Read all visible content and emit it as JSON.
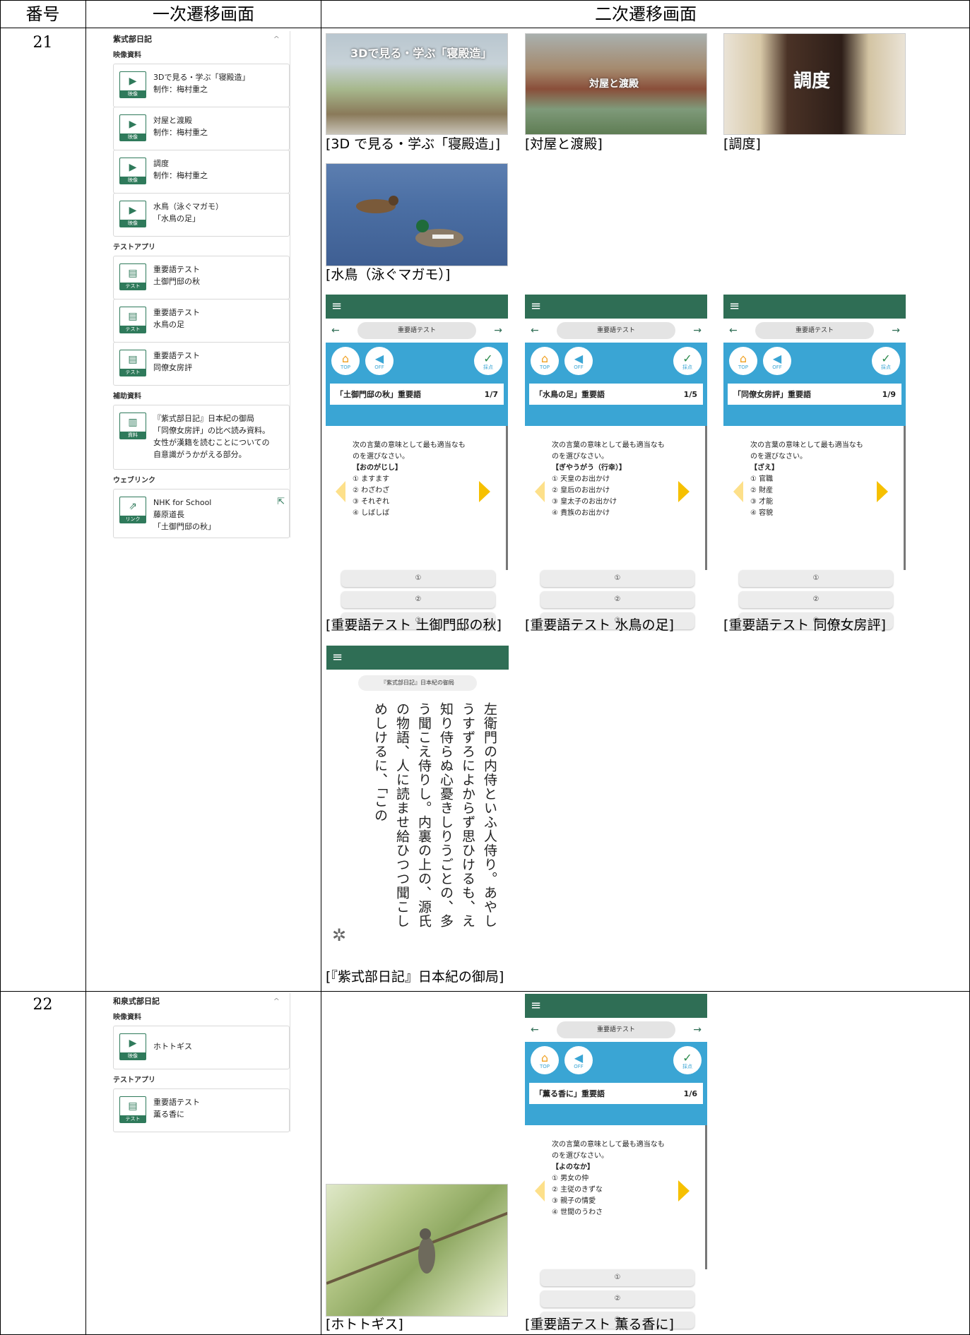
{
  "headers": {
    "num": "番号",
    "primary": "一次遷移画面",
    "secondary": "二次遷移画面"
  },
  "rows": [
    {
      "number": "21",
      "panel": {
        "title": "紫式部日記",
        "sections": {
          "video": "映像資料",
          "test": "テストアプリ",
          "aux": "補助資料",
          "web": "ウェブリンク"
        },
        "videos": [
          {
            "title": "3Dで見る・学ぶ「寝殿造」",
            "sub": "制作：梅村重之"
          },
          {
            "title": "対屋と渡殿",
            "sub": "制作：梅村重之"
          },
          {
            "title": "調度",
            "sub": "制作：梅村重之"
          },
          {
            "title": "水鳥（泳ぐマガモ）",
            "sub": "「水鳥の足」"
          }
        ],
        "tests": [
          {
            "title": "重要語テスト",
            "sub": "土御門邸の秋"
          },
          {
            "title": "重要語テスト",
            "sub": "水鳥の足"
          },
          {
            "title": "重要語テスト",
            "sub": "同僚女房評"
          }
        ],
        "aux": {
          "l1": "『紫式部日記』日本紀の御局",
          "l2": "「同僚女房評」の比べ読み資料。",
          "l3": "女性が漢籍を読むことについての",
          "l4": "自意識がうかがえる部分。"
        },
        "web": {
          "title": "NHK for School",
          "l2": "藤原道長",
          "l3": "「土御門邸の秋」"
        }
      },
      "captions": {
        "c1": "[3D で見る・学ぶ「寝殿造」]",
        "c2": "[対屋と渡殿]",
        "c3": "[調度]",
        "c4": "[水鳥（泳ぐマガモ）]",
        "c5": "[重要語テスト 土御門邸の秋]",
        "c6": "[重要語テスト 水鳥の足]",
        "c7": "[重要語テスト 同僚女房評]",
        "c8": "[『紫式部日記』日本紀の御局]"
      },
      "image_titles": {
        "i1": "3Dで見る・学ぶ「寝殿造」",
        "i2": "対屋と渡殿",
        "i3": "調度"
      },
      "apps": [
        {
          "title": "「土御門邸の秋」重要語",
          "page": "1/7",
          "word": "【おのがじし】",
          "opts": [
            "① ますます",
            "② わざわざ",
            "③ それぞれ",
            "④ しばしば"
          ]
        },
        {
          "title": "「水鳥の足」重要語",
          "page": "1/5",
          "word": "【ぎやうがう（行幸）】",
          "opts": [
            "① 天皇のお出かけ",
            "② 皇后のお出かけ",
            "③ 皇太子のお出かけ",
            "④ 貴族のお出かけ"
          ]
        },
        {
          "title": "「同僚女房評」重要語",
          "page": "1/9",
          "word": "【ざえ】",
          "opts": [
            "① 官職",
            "② 財産",
            "③ 才能",
            "④ 容貌"
          ]
        }
      ],
      "reader": {
        "pill": "『紫式部日記』日本紀の御局",
        "text": "左衛門の内侍といふ人侍り。あやしうすずろによからず思ひけるも、え知り侍らぬ心憂きしりうごとの、多う聞こえ侍りし。内裏の上の、源氏の物語、人に読ませ給ひつつ聞こしめしけるに、「この"
      }
    },
    {
      "number": "22",
      "panel": {
        "title": "和泉式部日記",
        "sections": {
          "video": "映像資料",
          "test": "テストアプリ"
        },
        "videos": [
          {
            "title": "ホトトギス"
          }
        ],
        "tests": [
          {
            "title": "重要語テスト",
            "sub": "薫る香に"
          }
        ]
      },
      "captions": {
        "c1": "[ホトトギス]",
        "c2": "[重要語テスト 薫る香に]"
      },
      "app": {
        "title": "「薫る香に」重要語",
        "page": "1/6",
        "word": "【よのなか】",
        "opts": [
          "① 男女の仲",
          "② 主従のきずな",
          "③ 親子の情愛",
          "④ 世間のうわさ"
        ]
      }
    }
  ],
  "app_common": {
    "menu": "≡",
    "pill": "重要語テスト",
    "back": "←",
    "fwd": "→",
    "top": "TOP",
    "off": "OFF",
    "check": "採点",
    "prompt1": "次の言葉の意味として最も適当なも",
    "prompt2": "のを選びなさい。",
    "answers": [
      "①",
      "②",
      "③"
    ]
  },
  "icon_tags": {
    "video": "映像",
    "test": "テスト",
    "doc": "資料",
    "link": "リンク"
  }
}
